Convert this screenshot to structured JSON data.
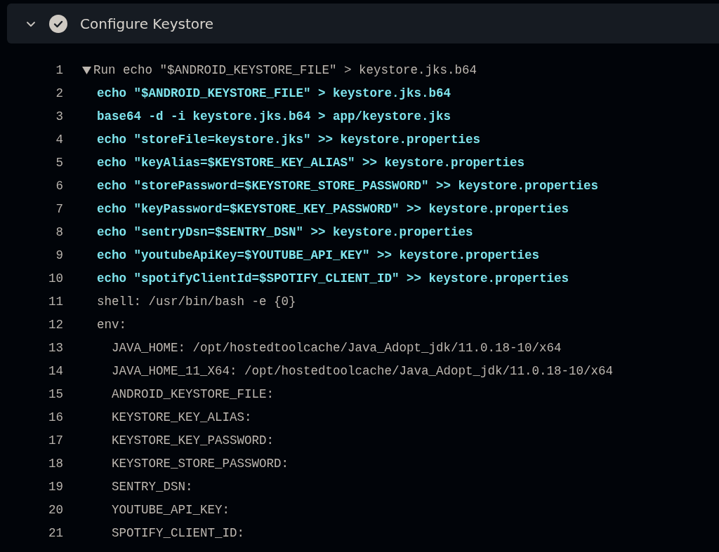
{
  "step": {
    "title": "Configure Keystore",
    "expanded": true,
    "succeeded": true
  },
  "run": {
    "number": "1",
    "text": "Run echo \"$ANDROID_KEYSTORE_FILE\" > keystore.jks.b64",
    "expanded": true
  },
  "lines": [
    {
      "number": "2",
      "kind": "command",
      "text": "echo \"$ANDROID_KEYSTORE_FILE\" > keystore.jks.b64"
    },
    {
      "number": "3",
      "kind": "command",
      "text": "base64 -d -i keystore.jks.b64 > app/keystore.jks"
    },
    {
      "number": "4",
      "kind": "command",
      "text": "echo \"storeFile=keystore.jks\" >> keystore.properties"
    },
    {
      "number": "5",
      "kind": "command",
      "text": "echo \"keyAlias=$KEYSTORE_KEY_ALIAS\" >> keystore.properties"
    },
    {
      "number": "6",
      "kind": "command",
      "text": "echo \"storePassword=$KEYSTORE_STORE_PASSWORD\" >> keystore.properties"
    },
    {
      "number": "7",
      "kind": "command",
      "text": "echo \"keyPassword=$KEYSTORE_KEY_PASSWORD\" >> keystore.properties"
    },
    {
      "number": "8",
      "kind": "command",
      "text": "echo \"sentryDsn=$SENTRY_DSN\" >> keystore.properties"
    },
    {
      "number": "9",
      "kind": "command",
      "text": "echo \"youtubeApiKey=$YOUTUBE_API_KEY\" >> keystore.properties"
    },
    {
      "number": "10",
      "kind": "command",
      "text": "echo \"spotifyClientId=$SPOTIFY_CLIENT_ID\" >> keystore.properties"
    },
    {
      "number": "11",
      "kind": "meta",
      "text": "shell: /usr/bin/bash -e {0}"
    },
    {
      "number": "12",
      "kind": "meta",
      "text": "env:",
      "children": [
        {
          "number": "13",
          "kind": "meta",
          "text": "JAVA_HOME: /opt/hostedtoolcache/Java_Adopt_jdk/11.0.18-10/x64"
        },
        {
          "number": "14",
          "kind": "meta",
          "text": "JAVA_HOME_11_X64: /opt/hostedtoolcache/Java_Adopt_jdk/11.0.18-10/x64"
        },
        {
          "number": "15",
          "kind": "meta",
          "text": "ANDROID_KEYSTORE_FILE:"
        },
        {
          "number": "16",
          "kind": "meta",
          "text": "KEYSTORE_KEY_ALIAS:"
        },
        {
          "number": "17",
          "kind": "meta",
          "text": "KEYSTORE_KEY_PASSWORD:"
        },
        {
          "number": "18",
          "kind": "meta",
          "text": "KEYSTORE_STORE_PASSWORD:"
        },
        {
          "number": "19",
          "kind": "meta",
          "text": "SENTRY_DSN:"
        },
        {
          "number": "20",
          "kind": "meta",
          "text": "YOUTUBE_API_KEY:"
        },
        {
          "number": "21",
          "kind": "meta",
          "text": "SPOTIFY_CLIENT_ID:"
        }
      ]
    }
  ]
}
